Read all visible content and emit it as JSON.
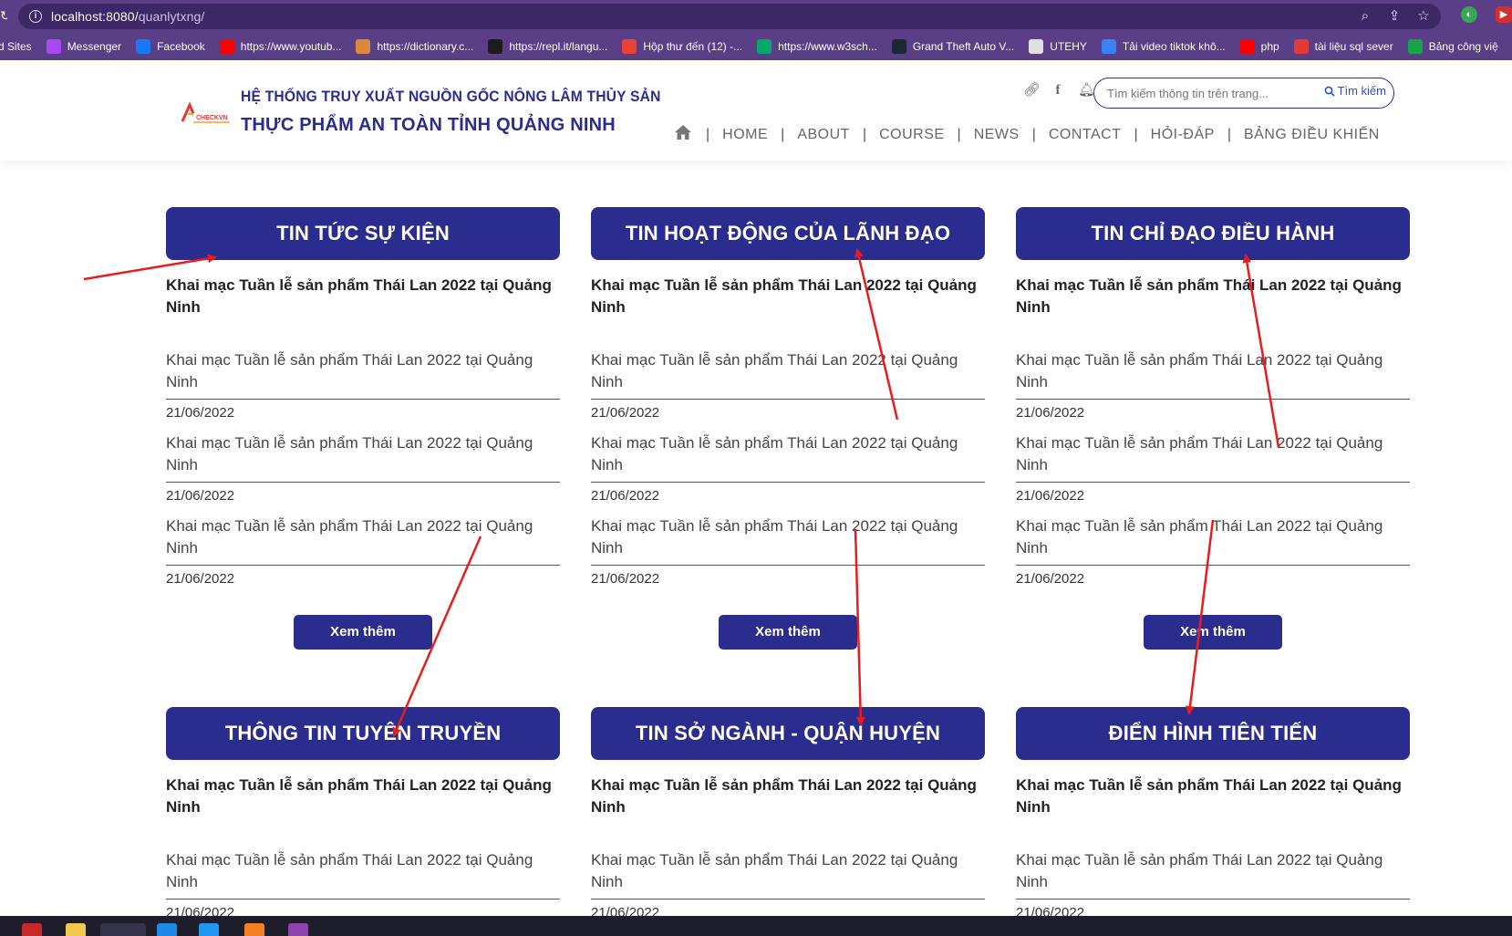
{
  "browser": {
    "url_host": "localhost:8080/",
    "url_path": "quanlytxng/",
    "bookmarks": [
      {
        "label": "d Sites",
        "icon": "sites-icon",
        "color": "#5a3f86"
      },
      {
        "label": "Messenger",
        "icon": "messenger-icon",
        "color": "#a64bf4"
      },
      {
        "label": "Facebook",
        "icon": "facebook-icon",
        "color": "#1877f2"
      },
      {
        "label": "https://www.youtub...",
        "icon": "youtube-icon",
        "color": "#ff0000"
      },
      {
        "label": "https://dictionary.c...",
        "icon": "dictionary-icon",
        "color": "#d98a3a"
      },
      {
        "label": "https://repl.it/langu...",
        "icon": "replit-icon",
        "color": "#1c1c1c"
      },
      {
        "label": "Hộp thư đến (12) -...",
        "icon": "gmail-icon",
        "color": "#ea4335"
      },
      {
        "label": "https://www.w3sch...",
        "icon": "w3schools-icon",
        "color": "#04aa6d"
      },
      {
        "label": "Grand Theft Auto V...",
        "icon": "steam-icon",
        "color": "#1b2838"
      },
      {
        "label": "UTEHY",
        "icon": "chrome-icon",
        "color": "#e0e0e0"
      },
      {
        "label": "Tải video tiktok khô...",
        "icon": "download-icon",
        "color": "#3b82f6"
      },
      {
        "label": "php",
        "icon": "youtube-icon",
        "color": "#ff0000"
      },
      {
        "label": "tài liệu sql sever",
        "icon": "t-icon",
        "color": "#e53935"
      },
      {
        "label": "Bảng công việ",
        "icon": "plus-icon",
        "color": "#16a34a"
      }
    ]
  },
  "header": {
    "brand_line1": "HỆ THỐNG TRUY XUẤT NGUỒN GỐC NÔNG LÂM THỦY SẢN",
    "brand_line2": "THỰC PHẨM AN TOÀN TỈNH QUẢNG NINH",
    "logo_text": "CHECKVN",
    "search": {
      "placeholder": "Tìm kiếm thông tin trên trang...",
      "button": "Tìm kiếm"
    },
    "nav": [
      "HOME",
      "ABOUT",
      "COURSE",
      "NEWS",
      "CONTACT",
      "HỎI-ĐÁP",
      "BẢNG ĐIỀU KHIỂN"
    ]
  },
  "sections": [
    {
      "title": "TIN TỨC SỰ KIỆN",
      "featured": "Khai mạc Tuần lễ sản phẩm Thái Lan 2022 tại Quảng Ninh",
      "items": [
        {
          "title": "Khai mạc Tuần lễ sản phẩm Thái Lan 2022 tại Quảng Ninh",
          "date": "21/06/2022"
        },
        {
          "title": "Khai mạc Tuần lễ sản phẩm Thái Lan 2022 tại Quảng Ninh",
          "date": "21/06/2022"
        },
        {
          "title": "Khai mạc Tuần lễ sản phẩm Thái Lan 2022 tại Quảng Ninh",
          "date": "21/06/2022"
        }
      ],
      "more": "Xem thêm"
    },
    {
      "title": "TIN HOẠT ĐỘNG CỦA LÃNH ĐẠO",
      "featured": "Khai mạc Tuần lễ sản phẩm Thái Lan 2022 tại Quảng Ninh",
      "items": [
        {
          "title": "Khai mạc Tuần lễ sản phẩm Thái Lan 2022 tại Quảng Ninh",
          "date": "21/06/2022"
        },
        {
          "title": "Khai mạc Tuần lễ sản phẩm Thái Lan 2022 tại Quảng Ninh",
          "date": "21/06/2022"
        },
        {
          "title": "Khai mạc Tuần lễ sản phẩm Thái Lan 2022 tại Quảng Ninh",
          "date": "21/06/2022"
        }
      ],
      "more": "Xem thêm"
    },
    {
      "title": "TIN CHỈ ĐẠO ĐIỀU HÀNH",
      "featured": "Khai mạc Tuần lễ sản phẩm Thái Lan 2022 tại Quảng Ninh",
      "items": [
        {
          "title": "Khai mạc Tuần lễ sản phẩm Thái Lan 2022 tại Quảng Ninh",
          "date": "21/06/2022"
        },
        {
          "title": "Khai mạc Tuần lễ sản phẩm Thái Lan 2022 tại Quảng Ninh",
          "date": "21/06/2022"
        },
        {
          "title": "Khai mạc Tuần lễ sản phẩm Thái Lan 2022 tại Quảng Ninh",
          "date": "21/06/2022"
        }
      ],
      "more": "Xem thêm"
    },
    {
      "title": "THÔNG TIN TUYÊN TRUYỀN",
      "featured": "Khai mạc Tuần lễ sản phẩm Thái Lan 2022 tại Quảng Ninh",
      "items": [
        {
          "title": "Khai mạc Tuần lễ sản phẩm Thái Lan 2022 tại Quảng Ninh",
          "date": "21/06/2022"
        }
      ]
    },
    {
      "title": "TIN SỞ NGÀNH - QUẬN HUYỆN",
      "featured": "Khai mạc Tuần lễ sản phẩm Thái Lan 2022 tại Quảng Ninh",
      "items": [
        {
          "title": "Khai mạc Tuần lễ sản phẩm Thái Lan 2022 tại Quảng Ninh",
          "date": "21/06/2022"
        }
      ]
    },
    {
      "title": "ĐIỂN HÌNH TIÊN TIẾN",
      "featured": "Khai mạc Tuần lễ sản phẩm Thái Lan 2022 tại Quảng Ninh",
      "items": [
        {
          "title": "Khai mạc Tuần lễ sản phẩm Thái Lan 2022 tại Quảng Ninh",
          "date": "21/06/2022"
        }
      ]
    }
  ],
  "annotation_color": "#e81c1c"
}
